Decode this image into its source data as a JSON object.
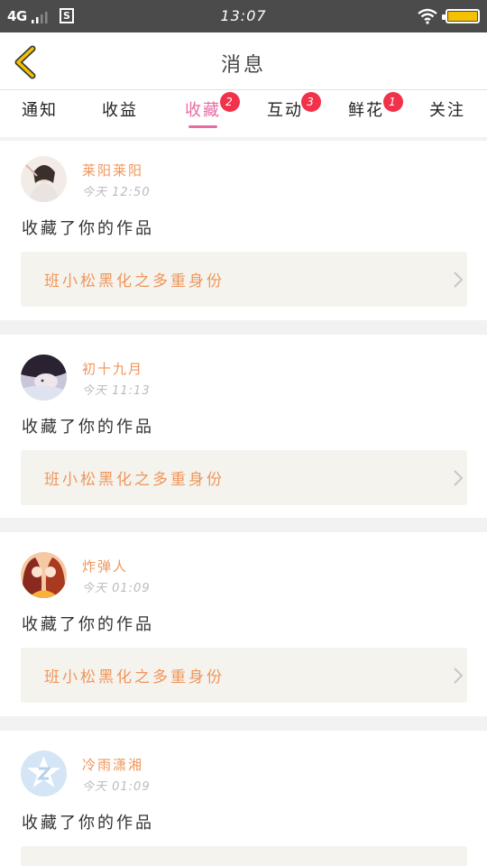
{
  "status_bar": {
    "network": "4G",
    "sim_icon": "S",
    "time": "13:07",
    "battery_level": 1.0,
    "icons": [
      "signal-bars-icon",
      "sim-icon",
      "wifi-icon",
      "battery-icon"
    ]
  },
  "header": {
    "back_icon": "chevron-left-icon",
    "title": "消息"
  },
  "tabs": [
    {
      "label": "通知",
      "badge": "",
      "active": false
    },
    {
      "label": "收益",
      "badge": "",
      "active": false
    },
    {
      "label": "收藏",
      "badge": "2",
      "active": true
    },
    {
      "label": "互动",
      "badge": "3",
      "active": false
    },
    {
      "label": "鲜花",
      "badge": "1",
      "active": false
    },
    {
      "label": "关注",
      "badge": "",
      "active": false
    }
  ],
  "messages": [
    {
      "user": "莱阳莱阳",
      "time": "今天 12:50",
      "action": "收藏了你的作品",
      "work_title": "班小松黑化之多重身份"
    },
    {
      "user": "初十九月",
      "time": "今天 11:13",
      "action": "收藏了你的作品",
      "work_title": "班小松黑化之多重身份"
    },
    {
      "user": "炸弹人",
      "time": "今天 01:09",
      "action": "收藏了你的作品",
      "work_title": "班小松黑化之多重身份"
    },
    {
      "user": "冷雨潇湘",
      "time": "今天 01:09",
      "action": "收藏了你的作品",
      "work_title": ""
    }
  ],
  "colors": {
    "accent_pink": "#e86ba3",
    "username_orange": "#f0955a",
    "badge_red": "#f0324a",
    "status_bar_bg": "#4b4b4b",
    "back_arrow_yellow": "#f2c200"
  }
}
